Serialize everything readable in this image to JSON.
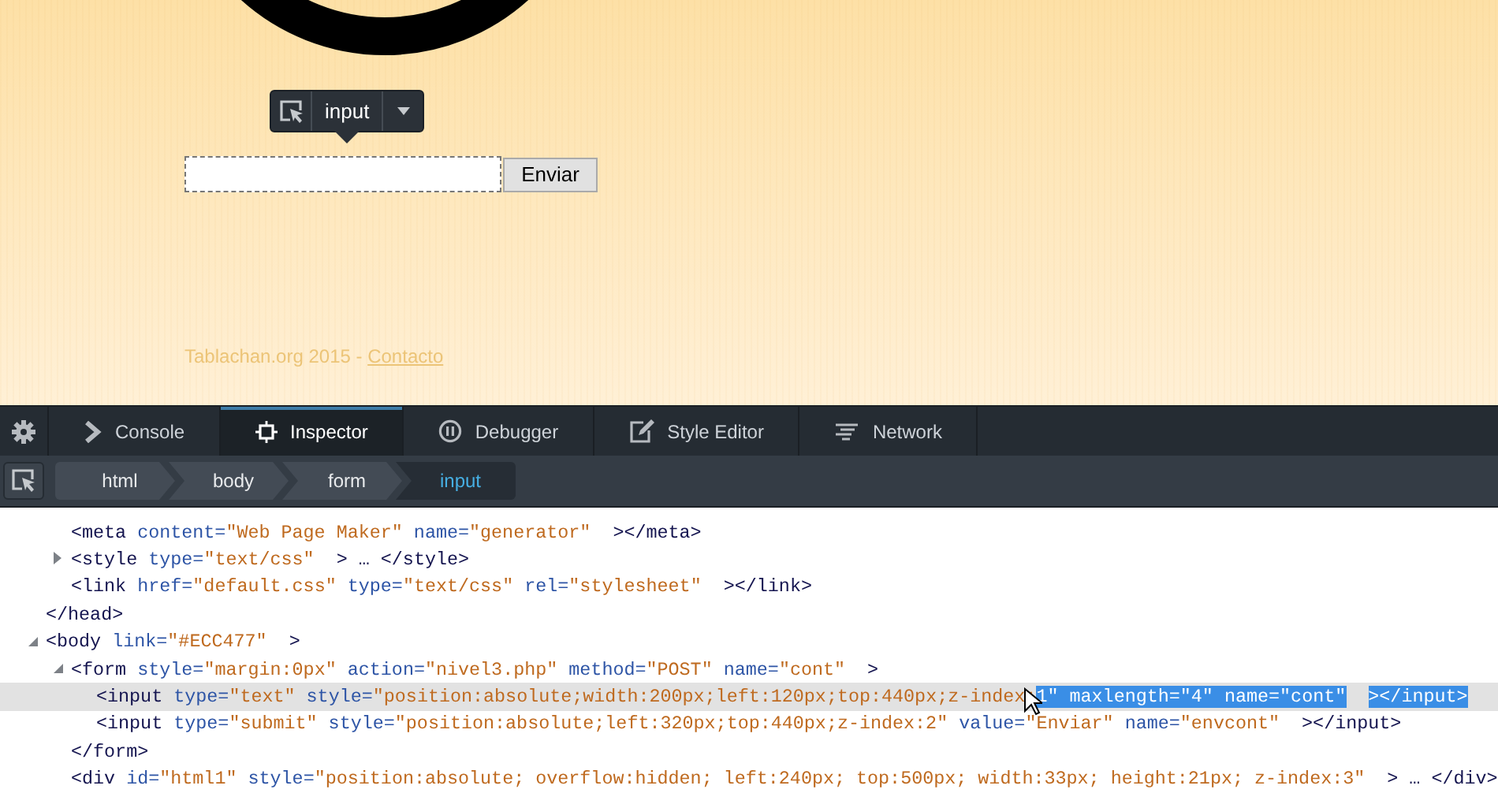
{
  "page": {
    "infobar": {
      "tag": "input"
    },
    "submit_button": "Enviar",
    "footer": {
      "text": "Tablachan.org 2015 - ",
      "link": "Contacto"
    }
  },
  "toolbar": {
    "tabs": [
      {
        "label": "Console",
        "selected": false
      },
      {
        "label": "Inspector",
        "selected": true
      },
      {
        "label": "Debugger",
        "selected": false
      },
      {
        "label": "Style Editor",
        "selected": false
      },
      {
        "label": "Network",
        "selected": false
      }
    ]
  },
  "breadcrumbs": [
    {
      "label": "html",
      "selected": false
    },
    {
      "label": "body",
      "selected": false
    },
    {
      "label": "form",
      "selected": false
    },
    {
      "label": "input",
      "selected": true
    }
  ],
  "markup": [
    {
      "children": [
        {
          "selected": false,
          "segments": [
            {
              "kind": "tag",
              "text": "<meta"
            },
            {
              "kind": "attr",
              "text": " content="
            },
            {
              "kind": "value",
              "text": "\"Web Page Maker\""
            },
            {
              "kind": "attr",
              "text": " name="
            },
            {
              "kind": "value",
              "text": "\"generator\""
            },
            {
              "kind": "close",
              "text": "></meta>"
            }
          ]
        },
        {
          "selected": false,
          "expanded": false,
          "segments": [
            {
              "kind": "tag",
              "text": "<style"
            },
            {
              "kind": "attr",
              "text": " type="
            },
            {
              "kind": "value",
              "text": "\"text/css\""
            },
            {
              "kind": "close",
              "text": "> … </style>"
            }
          ]
        },
        {
          "selected": false,
          "segments": [
            {
              "kind": "tag",
              "text": "<link"
            },
            {
              "kind": "attr",
              "text": " href="
            },
            {
              "kind": "value",
              "text": "\"default.css\""
            },
            {
              "kind": "attr",
              "text": " type="
            },
            {
              "kind": "value",
              "text": "\"text/css\""
            },
            {
              "kind": "attr",
              "text": " rel="
            },
            {
              "kind": "value",
              "text": "\"stylesheet\""
            },
            {
              "kind": "close",
              "text": "></link>"
            }
          ]
        }
      ],
      "closing": [
        {
          "kind": "tag",
          "text": "</head>"
        }
      ]
    },
    {
      "selected": false,
      "expanded": true,
      "segments": [
        {
          "kind": "tag",
          "text": "<body"
        },
        {
          "kind": "attr",
          "text": " link="
        },
        {
          "kind": "value",
          "text": "\"#ECC477\""
        },
        {
          "kind": "close",
          "text": ">"
        }
      ],
      "children": [
        {
          "selected": false,
          "expanded": true,
          "segments": [
            {
              "kind": "tag",
              "text": "<form"
            },
            {
              "kind": "attr",
              "text": " style="
            },
            {
              "kind": "value",
              "text": "\"margin:0px\""
            },
            {
              "kind": "attr",
              "text": " action="
            },
            {
              "kind": "value",
              "text": "\"nivel3.php\""
            },
            {
              "kind": "attr",
              "text": " method="
            },
            {
              "kind": "value",
              "text": "\"POST\""
            },
            {
              "kind": "attr",
              "text": " name="
            },
            {
              "kind": "value",
              "text": "\"cont\""
            },
            {
              "kind": "close",
              "text": ">"
            }
          ],
          "children": [
            {
              "selected": true,
              "segments": [
                {
                  "kind": "tag",
                  "text": "<input"
                },
                {
                  "kind": "attr",
                  "text": " type="
                },
                {
                  "kind": "value",
                  "text": "\"text\""
                },
                {
                  "kind": "attr",
                  "text": " style="
                },
                {
                  "kind": "value",
                  "text": "\"position:absolute;width:200px;left:120px;top:440px;z-index:"
                },
                {
                  "kind": "value",
                  "text": "1\"",
                  "text_selected": true
                },
                {
                  "kind": "attr",
                  "text": " maxlength=",
                  "text_selected": true
                },
                {
                  "kind": "value",
                  "text": "\"4\"",
                  "text_selected": true
                },
                {
                  "kind": "attr",
                  "text": " name=",
                  "text_selected": true
                },
                {
                  "kind": "value",
                  "text": "\"cont\"",
                  "text_selected": true
                },
                {
                  "kind": "close",
                  "text": "></input>",
                  "text_selected": true
                }
              ]
            },
            {
              "selected": false,
              "segments": [
                {
                  "kind": "tag",
                  "text": "<input"
                },
                {
                  "kind": "attr",
                  "text": " type="
                },
                {
                  "kind": "value",
                  "text": "\"submit\""
                },
                {
                  "kind": "attr",
                  "text": " style="
                },
                {
                  "kind": "value",
                  "text": "\"position:absolute;left:320px;top:440px;z-index:2\""
                },
                {
                  "kind": "attr",
                  "text": " value="
                },
                {
                  "kind": "value",
                  "text": "\"Enviar\""
                },
                {
                  "kind": "attr",
                  "text": " name="
                },
                {
                  "kind": "value",
                  "text": "\"envcont\""
                },
                {
                  "kind": "close",
                  "text": "></input>"
                }
              ]
            }
          ],
          "closing": [
            {
              "kind": "tag",
              "text": "</form>"
            }
          ]
        },
        {
          "selected": false,
          "segments": [
            {
              "kind": "tag",
              "text": "<div"
            },
            {
              "kind": "attr",
              "text": " id="
            },
            {
              "kind": "value",
              "text": "\"html1\""
            },
            {
              "kind": "attr",
              "text": " style="
            },
            {
              "kind": "value",
              "text": "\"position:absolute; overflow:hidden; left:240px; top:500px; width:33px; height:21px; z-index:3\""
            },
            {
              "kind": "close",
              "text": "> … </div>"
            }
          ]
        }
      ]
    }
  ]
}
